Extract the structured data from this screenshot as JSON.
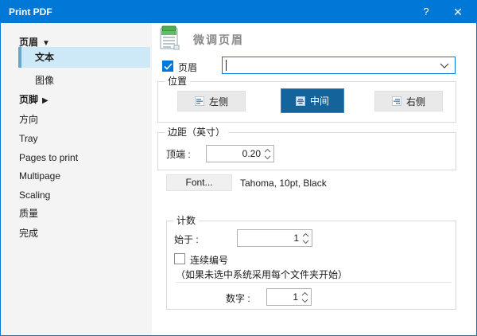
{
  "titlebar": {
    "title": "Print PDF",
    "help_label": "?",
    "close_label": "✕"
  },
  "sidebar": {
    "items": [
      {
        "label": "页眉"
      },
      {
        "label": "文本"
      },
      {
        "label": "图像"
      },
      {
        "label": "页脚"
      },
      {
        "label": "方向"
      },
      {
        "label": "Tray"
      },
      {
        "label": "Pages to print"
      },
      {
        "label": "Multipage"
      },
      {
        "label": "Scaling"
      },
      {
        "label": "质量"
      },
      {
        "label": "完成"
      }
    ]
  },
  "main": {
    "page_title": "微调页眉",
    "header_checkbox_label": "页眉",
    "header_combobox_value": "",
    "position_group": {
      "legend": "位置",
      "buttons": [
        {
          "label": "左侧",
          "selected": false
        },
        {
          "label": "中间",
          "selected": true
        },
        {
          "label": "右侧",
          "selected": false
        }
      ]
    },
    "margin_group": {
      "legend": "边距（英寸）",
      "top_label": "顶端 :",
      "top_value": "0.20"
    },
    "font_row": {
      "button_label": "Font...",
      "summary": "Tahoma, 10pt, Black"
    },
    "count_group": {
      "legend": "计数",
      "start_label": "始于 :",
      "start_value": "1",
      "continuous_label": "连续编号",
      "continuous_note": "（如果未选中系统采用每个文件夹开始）",
      "number_label": "数字 :",
      "number_value": "1"
    }
  },
  "colors": {
    "titlebar": "#0078d7",
    "selected_button": "#15639b",
    "sidebar_selection_bg": "#cde8f6",
    "sidebar_selection_accent": "#64a8d2",
    "combobox_focus_border": "#0078d7"
  }
}
